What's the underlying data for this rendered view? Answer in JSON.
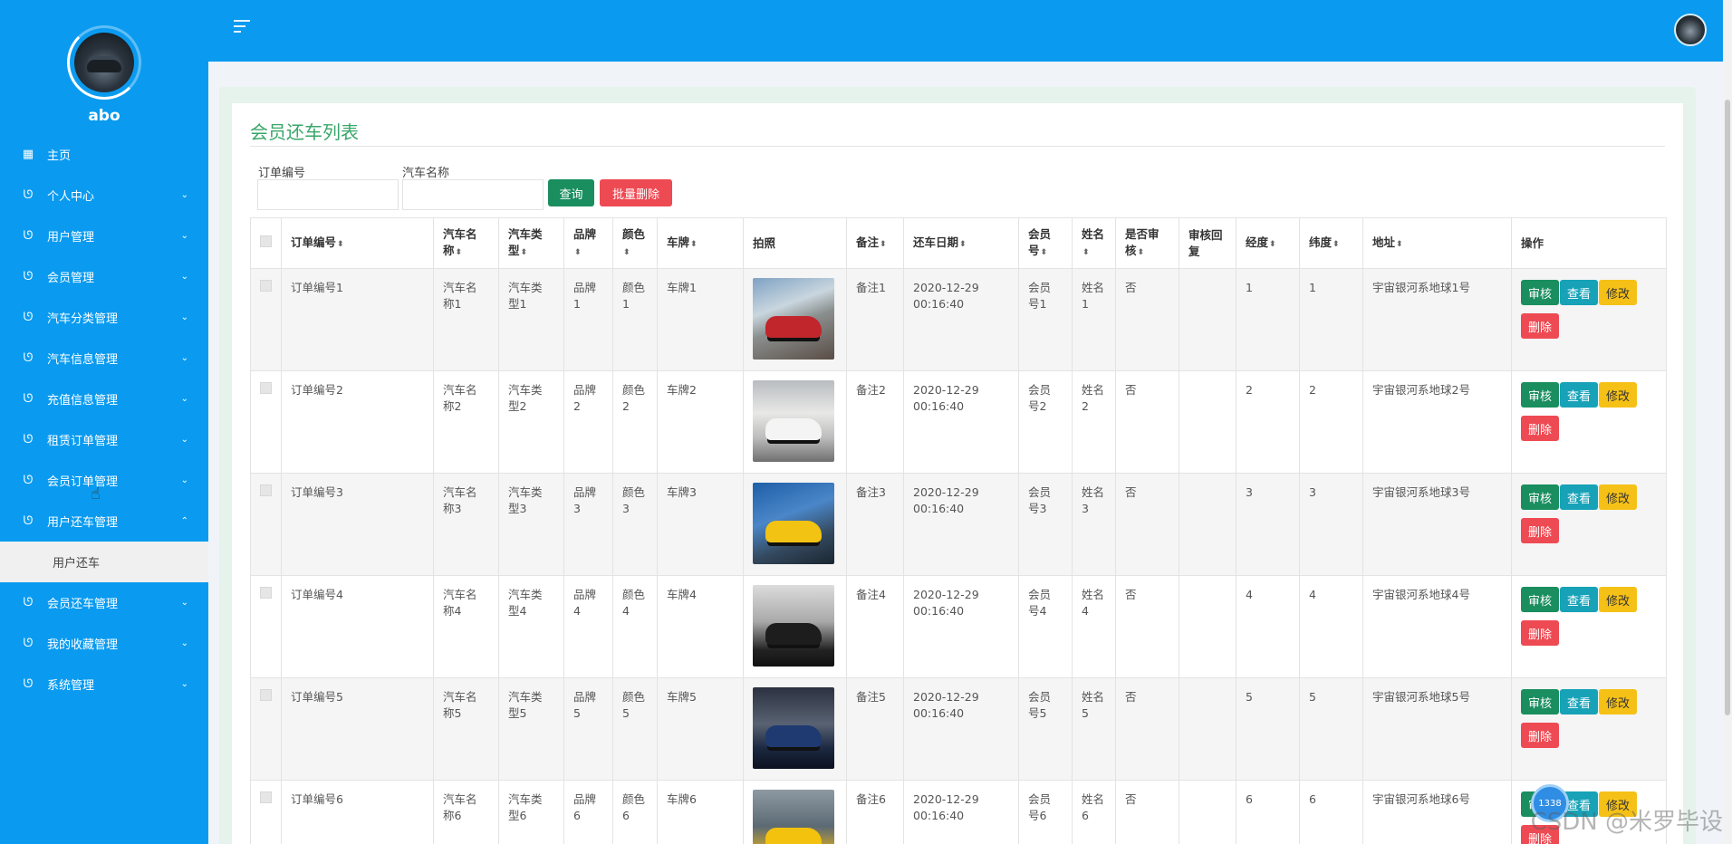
{
  "sidebar": {
    "username": "abo",
    "items": [
      {
        "label": "主页",
        "icon": "dashboard-icon",
        "has_chevron": false
      },
      {
        "label": "个人中心",
        "icon": "stethoscope-icon",
        "chevron": "⌄"
      },
      {
        "label": "用户管理",
        "icon": "stethoscope-icon",
        "chevron": "⌄"
      },
      {
        "label": "会员管理",
        "icon": "stethoscope-icon",
        "chevron": "⌄"
      },
      {
        "label": "汽车分类管理",
        "icon": "stethoscope-icon",
        "chevron": "⌄"
      },
      {
        "label": "汽车信息管理",
        "icon": "stethoscope-icon",
        "chevron": "⌄"
      },
      {
        "label": "充值信息管理",
        "icon": "stethoscope-icon",
        "chevron": "⌄"
      },
      {
        "label": "租赁订单管理",
        "icon": "stethoscope-icon",
        "chevron": "⌄"
      },
      {
        "label": "会员订单管理",
        "icon": "stethoscope-icon",
        "chevron": "⌄"
      },
      {
        "label": "用户还车管理",
        "icon": "stethoscope-icon",
        "chevron": "⌃"
      },
      {
        "label": "会员还车管理",
        "icon": "stethoscope-icon",
        "chevron": "⌄"
      },
      {
        "label": "我的收藏管理",
        "icon": "stethoscope-icon",
        "chevron": "⌄"
      },
      {
        "label": "系统管理",
        "icon": "stethoscope-icon",
        "chevron": "⌄"
      }
    ],
    "submenu": {
      "label": "用户还车"
    }
  },
  "main": {
    "title": "会员还车列表",
    "search": {
      "order_label": "订单编号",
      "order_value": "",
      "car_label": "汽车名称",
      "car_value": "",
      "query_btn": "查询",
      "batch_delete_btn": "批量删除"
    },
    "columns": [
      "订单编号",
      "汽车名\n称",
      "汽车类\n型",
      "品牌",
      "颜色",
      "车牌",
      "拍照",
      "备注",
      "还车日期",
      "会员\n号",
      "姓名",
      "是否审\n核",
      "审核回\n复",
      "经度",
      "纬度",
      "地址",
      "操作"
    ],
    "sortable": [
      true,
      true,
      true,
      true,
      true,
      true,
      false,
      true,
      true,
      true,
      true,
      true,
      false,
      true,
      true,
      true,
      false
    ],
    "rows": [
      {
        "order": "订单编号1",
        "car": "汽车名\n称1",
        "type": "汽车类\n型1",
        "brand": "品牌\n1",
        "color": "颜色\n1",
        "plate": "车牌1",
        "note": "备注1",
        "date": "2020-12-29\n00:16:40",
        "member": "会员\n号1",
        "name": "姓名\n1",
        "audited": "否",
        "reply": "",
        "lng": "1",
        "lat": "1",
        "addr": "宇宙银河系地球1号",
        "photo_theme": "red-suv"
      },
      {
        "order": "订单编号2",
        "car": "汽车名\n称2",
        "type": "汽车类\n型2",
        "brand": "品牌\n2",
        "color": "颜色\n2",
        "plate": "车牌2",
        "note": "备注2",
        "date": "2020-12-29\n00:16:40",
        "member": "会员\n号2",
        "name": "姓名\n2",
        "audited": "否",
        "reply": "",
        "lng": "2",
        "lat": "2",
        "addr": "宇宙银河系地球2号",
        "photo_theme": "white-coupe"
      },
      {
        "order": "订单编号3",
        "car": "汽车名\n称3",
        "type": "汽车类\n型3",
        "brand": "品牌\n3",
        "color": "颜色\n3",
        "plate": "车牌3",
        "note": "备注3",
        "date": "2020-12-29\n00:16:40",
        "member": "会员\n号3",
        "name": "姓名\n3",
        "audited": "否",
        "reply": "",
        "lng": "3",
        "lat": "3",
        "addr": "宇宙银河系地球3号",
        "photo_theme": "yellow-sport"
      },
      {
        "order": "订单编号4",
        "car": "汽车名\n称4",
        "type": "汽车类\n型4",
        "brand": "品牌\n4",
        "color": "颜色\n4",
        "plate": "车牌4",
        "note": "备注4",
        "date": "2020-12-29\n00:16:40",
        "member": "会员\n号4",
        "name": "姓名\n4",
        "audited": "否",
        "reply": "",
        "lng": "4",
        "lat": "4",
        "addr": "宇宙银河系地球4号",
        "photo_theme": "black-muscle"
      },
      {
        "order": "订单编号5",
        "car": "汽车名\n称5",
        "type": "汽车类\n型5",
        "brand": "品牌\n5",
        "color": "颜色\n5",
        "plate": "车牌5",
        "note": "备注5",
        "date": "2020-12-29\n00:16:40",
        "member": "会员\n号5",
        "name": "姓名\n5",
        "audited": "否",
        "reply": "",
        "lng": "5",
        "lat": "5",
        "addr": "宇宙银河系地球5号",
        "photo_theme": "dark-sedan"
      },
      {
        "order": "订单编号6",
        "car": "汽车名\n称6",
        "type": "汽车类\n型6",
        "brand": "品牌\n6",
        "color": "颜色\n6",
        "plate": "车牌6",
        "note": "备注6",
        "date": "2020-12-29\n00:16:40",
        "member": "会员\n号6",
        "name": "姓名\n6",
        "audited": "否",
        "reply": "",
        "lng": "6",
        "lat": "6",
        "addr": "宇宙银河系地球6号",
        "photo_theme": "yellow-jet"
      }
    ],
    "row_actions": {
      "audit": "审核",
      "view": "查看",
      "edit": "修改",
      "delete": "删除"
    }
  },
  "overlay": {
    "watermark": "CSDN @米罗毕设",
    "float_ball": "1338"
  },
  "colors": {
    "brand": "#0a9bf0",
    "title_green": "#3aa66a",
    "audit": "#1a8e5f",
    "view": "#17a2b8",
    "edit": "#f5c117",
    "delete": "#ee4a53"
  }
}
